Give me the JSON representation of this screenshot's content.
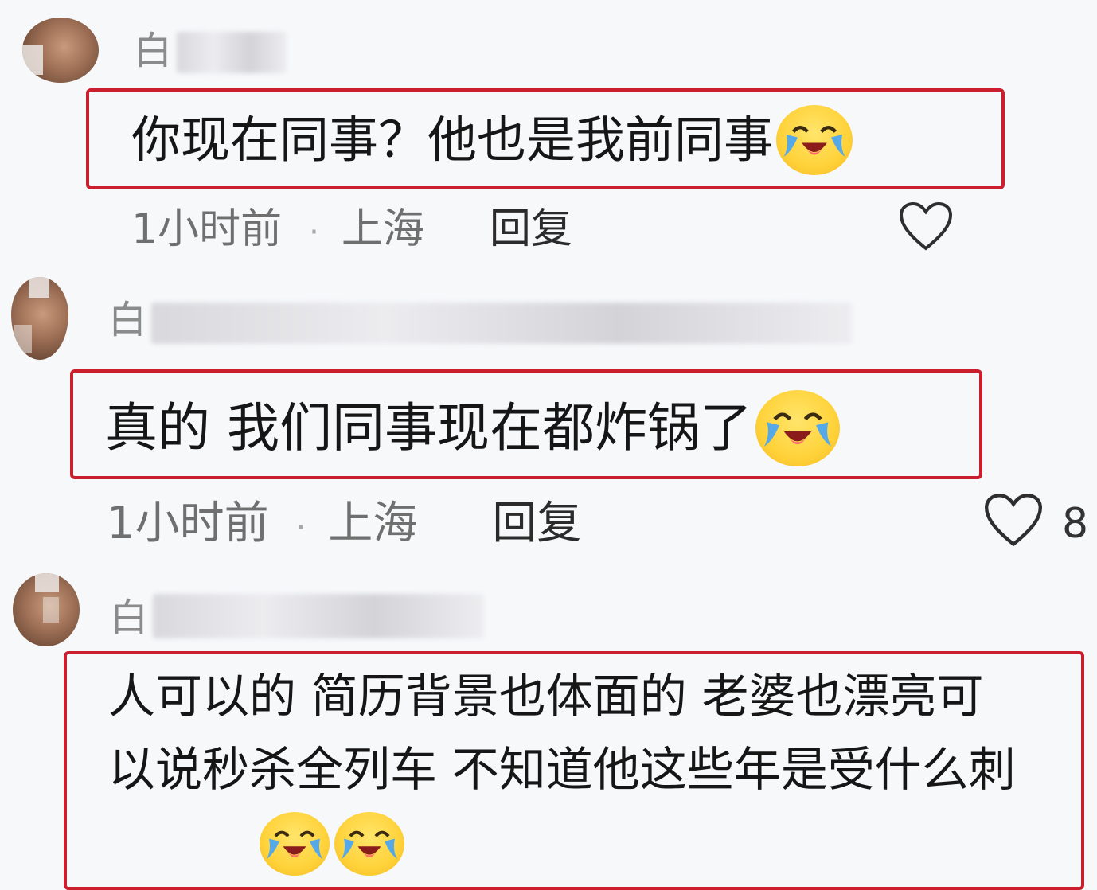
{
  "comments": [
    {
      "username_visible": "白",
      "message": "你现在同事？他也是我前同事",
      "emoji": "laugh-cry-emoji",
      "time": "1小时前",
      "separator": "·",
      "location": "上海",
      "reply_label": "回复"
    },
    {
      "username_visible": "白",
      "message": "真的 我们同事现在都炸锅了",
      "emoji": "laugh-cry-emoji",
      "time": "1小时前",
      "separator": "·",
      "location": "上海",
      "reply_label": "回复",
      "like_count": "8"
    },
    {
      "username_visible": "白",
      "message_line1": "人可以的 简历背景也体面的 老婆也漂亮可",
      "message_line2": "以说秒杀全列车 不知道他这些年是受什么刺",
      "emoji": "laugh-cry-emoji"
    }
  ],
  "colors": {
    "highlight_border": "#cc1f2d",
    "background": "#f7f8fa",
    "meta_text": "#6f6f6f"
  }
}
